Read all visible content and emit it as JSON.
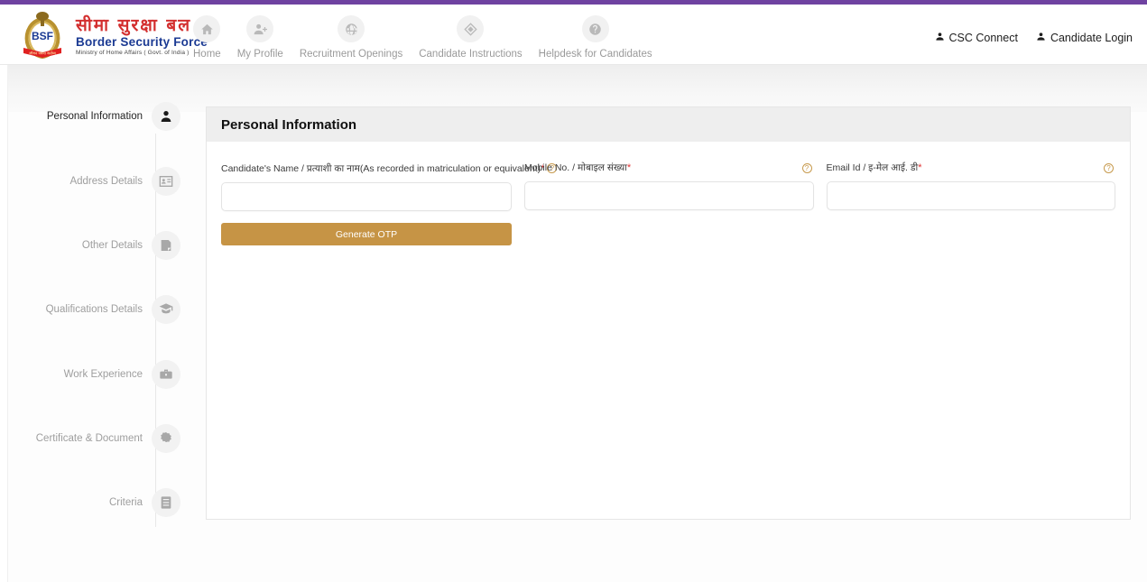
{
  "theme": {
    "topbar_color": "#6f42a1",
    "accent_gold": "#c69445",
    "brand_red": "#d32f2f",
    "brand_blue": "#1b3a93",
    "required_red": "#e03131"
  },
  "brand": {
    "emblem_icon": "bsf-emblem-icon",
    "abbr": "BSF",
    "name_hi": "सीमा सुरक्षा बल",
    "name_en": "Border Security Force",
    "ministry": "Ministry of Home Affairs ( Govt. of India )"
  },
  "nav": {
    "items": [
      {
        "label": "Home",
        "icon": "home-icon"
      },
      {
        "label": "My Profile",
        "icon": "user-plus-icon"
      },
      {
        "label": "Recruitment Openings",
        "icon": "globe-icon"
      },
      {
        "label": "Candidate Instructions",
        "icon": "diamond-icon"
      },
      {
        "label": "Helpdesk for Candidates",
        "icon": "question-circle-icon"
      }
    ]
  },
  "header_links": [
    {
      "label": "CSC Connect",
      "icon": "user-icon"
    },
    {
      "label": "Candidate Login",
      "icon": "user-icon"
    }
  ],
  "stepper": {
    "items": [
      {
        "label": "Personal Information",
        "icon": "user-icon",
        "active": true
      },
      {
        "label": "Address Details",
        "icon": "id-card-icon",
        "active": false
      },
      {
        "label": "Other Details",
        "icon": "note-icon",
        "active": false
      },
      {
        "label": "Qualifications Details",
        "icon": "graduation-cap-icon",
        "active": false
      },
      {
        "label": "Work Experience",
        "icon": "briefcase-icon",
        "active": false
      },
      {
        "label": "Certificate & Document",
        "icon": "certificate-icon",
        "active": false
      },
      {
        "label": "Criteria",
        "icon": "book-icon",
        "active": false
      }
    ]
  },
  "card": {
    "title": "Personal Information",
    "fields": [
      {
        "label": "Candidate's Name / प्रत्याशी का नाम(As recorded in matriculation or equivalent)",
        "required": "*",
        "value": "",
        "placeholder": "",
        "help_icon": "question-circle-icon",
        "help_position": "inline"
      },
      {
        "label": "Mobile No. / मोबाइल संख्या",
        "required": "*",
        "value": "",
        "placeholder": "",
        "help_icon": "question-circle-icon",
        "help_position": "right"
      },
      {
        "label": "Email Id / इ-मेल आई. डी",
        "required": "*",
        "value": "",
        "placeholder": "",
        "help_icon": "question-circle-icon",
        "help_position": "right"
      }
    ],
    "generate_otp_label": "Generate OTP"
  }
}
